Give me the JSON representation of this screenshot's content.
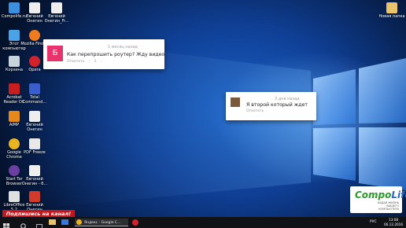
{
  "desktop": {
    "icons_left": [
      {
        "label": "Compolife.ru",
        "color": "#3b8ee0"
      },
      {
        "label": "Этот компьютер",
        "color": "#4aa3e6"
      },
      {
        "label": "Корзина",
        "color": "#c9d3dc"
      },
      {
        "label": "Acrobat Reader DC",
        "color": "#c81e1e"
      },
      {
        "label": "AIMP",
        "color": "#e58a1a"
      },
      {
        "label": "Google Chrome",
        "color": "#e9b321"
      },
      {
        "label": "Start Tor Browser",
        "color": "#6b3fa0"
      },
      {
        "label": "LibreOffice 5.2",
        "color": "#e0e0e0"
      }
    ],
    "icons_col2": [
      {
        "label": "Евгений Онегин",
        "color": "#eeeeee"
      },
      {
        "label": "Mozilla Firefox",
        "color": "#f07a1f"
      },
      {
        "label": "Opera",
        "color": "#d3222a"
      },
      {
        "label": "Total Command...",
        "color": "#3a5fcd"
      },
      {
        "label": "Евгений Онегин",
        "color": "#eeeeee"
      },
      {
        "label": "PDF Freeze",
        "color": "#e8e8e8"
      },
      {
        "label": "Евгений Онегин - б...",
        "color": "#eeeeee"
      },
      {
        "label": "Евгений Онегин",
        "color": "#d23a2a"
      }
    ],
    "icon_col3": {
      "label": "Евгений Онегин_Fr...",
      "color": "#eeeeee"
    },
    "icon_right": {
      "label": "Новая папка",
      "color": "#e9c46a"
    }
  },
  "comments": [
    {
      "avatar_letter": "Б",
      "avatar_color": "#e8336d",
      "time": "1 месяц назад",
      "text": "Как перепрошить роутер? Жду видео",
      "reply": "Ответить",
      "likes": "2"
    },
    {
      "avatar_color": "#7a5a3a",
      "time": "3 дня назад",
      "text": "Я второй который ждет",
      "reply": "Ответить"
    }
  ],
  "promo": {
    "text": "Подпишись на канал!"
  },
  "logo": {
    "brand_part1": "Compo",
    "brand_part2": "Life",
    "tagline": "НАДАЯ ЖИЗНЬ ВАШЕГО КОМПЬЮТЕРА"
  },
  "taskbar": {
    "app_label": "Яндекс - Google C...",
    "lang": "РУС",
    "time": "13:08",
    "date": "06.12.2016"
  }
}
